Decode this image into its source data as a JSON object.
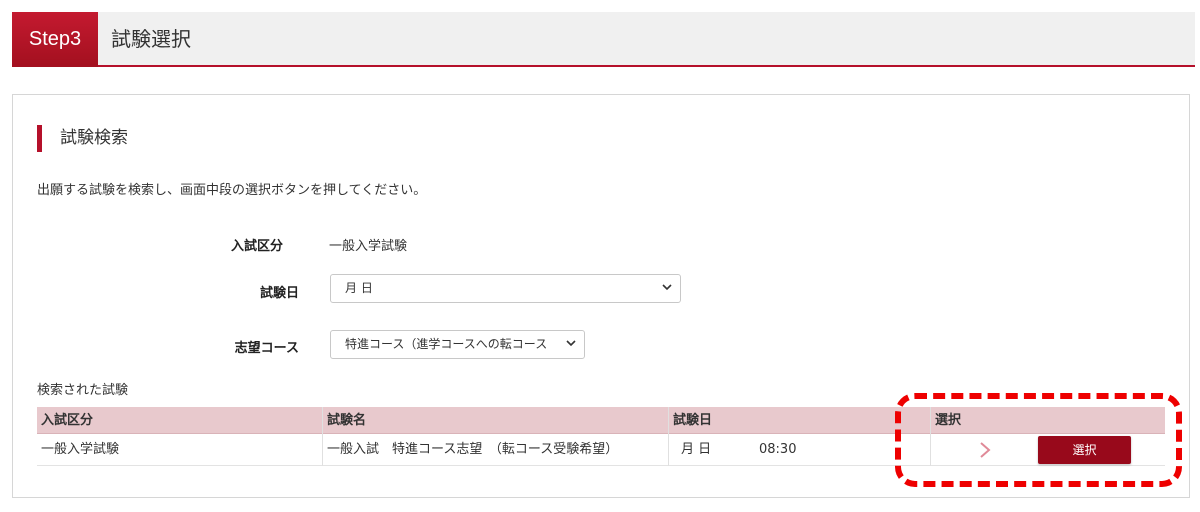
{
  "header": {
    "step_badge": "Step3",
    "title": "試験選択"
  },
  "search": {
    "section_title": "試験検索",
    "intro": "出願する試験を検索し、画面中段の選択ボタンを押してください。",
    "fields": {
      "exam_type_label": "入試区分",
      "exam_type_value": "一般入学試験",
      "exam_date_label": "試験日",
      "exam_date_value": "月 日",
      "course_label": "志望コース",
      "course_value": "特進コース（進学コースへの転コース"
    }
  },
  "results": {
    "label": "検索された試験",
    "columns": [
      "入試区分",
      "試験名",
      "試験日",
      "選択"
    ],
    "rows": [
      {
        "exam_type": "一般入学試験",
        "exam_name": "一般入試　特進コース志望　（転コース受験希望）",
        "exam_date": "月 日",
        "exam_time": "08:30",
        "select_label": "選択"
      }
    ]
  },
  "icons": {
    "select_chevron": "chevron-down-icon",
    "row_arrow": "chevron-right-icon"
  },
  "colors": {
    "accent": "#b5102a",
    "button": "#98091b",
    "table_header": "#e8c9cd",
    "highlight": "#ee0000"
  }
}
